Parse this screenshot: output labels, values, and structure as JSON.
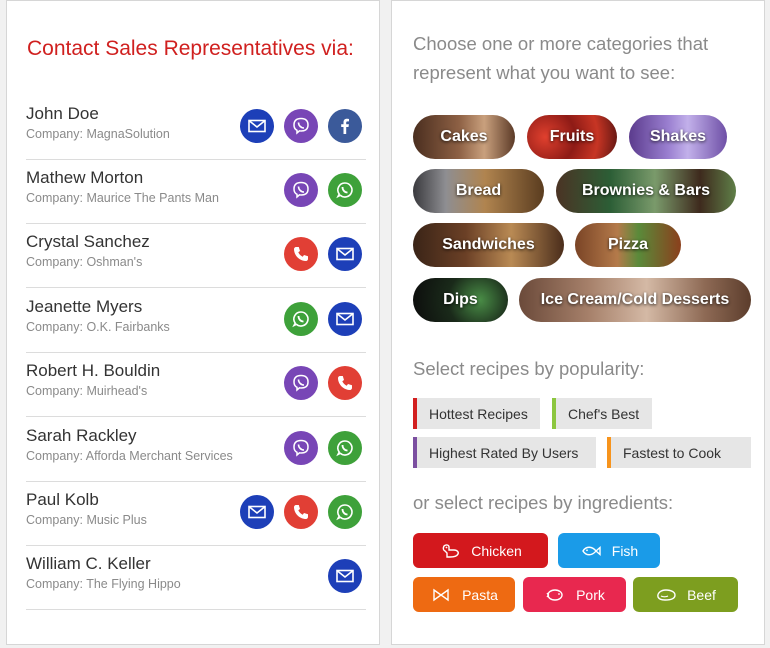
{
  "contacts_panel": {
    "title": "Contact Sales Representatives via:",
    "contacts": [
      {
        "name": "John Doe",
        "company": "Company: MagnaSolution",
        "channels": [
          "email",
          "viber",
          "facebook"
        ]
      },
      {
        "name": "Mathew Morton",
        "company": "Company: Maurice The Pants Man",
        "channels": [
          "viber",
          "whatsapp"
        ]
      },
      {
        "name": "Crystal Sanchez",
        "company": "Company: Oshman's",
        "channels": [
          "phone",
          "email"
        ]
      },
      {
        "name": "Jeanette Myers",
        "company": "Company: O.K. Fairbanks",
        "channels": [
          "whatsapp",
          "email"
        ]
      },
      {
        "name": "Robert H. Bouldin",
        "company": "Company: Muirhead's",
        "channels": [
          "viber",
          "phone"
        ]
      },
      {
        "name": "Sarah Rackley",
        "company": "Company: Afforda Merchant Services",
        "channels": [
          "viber",
          "whatsapp"
        ]
      },
      {
        "name": "Paul Kolb",
        "company": "Company: Music Plus",
        "channels": [
          "email",
          "phone",
          "whatsapp"
        ]
      },
      {
        "name": "William C. Keller",
        "company": "Company: The Flying Hippo",
        "channels": [
          "email"
        ]
      }
    ]
  },
  "recipes_panel": {
    "categories_prompt_line1": "Choose one or more categories that",
    "categories_prompt_line2": "represent what you want to see:",
    "categories": [
      {
        "label": "Cakes",
        "icon": "cake-photo"
      },
      {
        "label": "Fruits",
        "icon": "fruits-photo"
      },
      {
        "label": "Shakes",
        "icon": "shakes-photo"
      },
      {
        "label": "Bread",
        "icon": "bread-photo"
      },
      {
        "label": "Brownies & Bars",
        "icon": "brownies-photo"
      },
      {
        "label": "Sandwiches",
        "icon": "sandwiches-photo"
      },
      {
        "label": "Pizza",
        "icon": "pizza-photo"
      },
      {
        "label": "Dips",
        "icon": "dips-photo"
      },
      {
        "label": "Ice Cream/Cold Desserts",
        "icon": "ice-cream-photo"
      }
    ],
    "popularity_prompt": "Select recipes by popularity:",
    "popularity": [
      {
        "label": "Hottest Recipes",
        "color": "#d21f1f"
      },
      {
        "label": "Chef's Best",
        "color": "#8cc63f"
      },
      {
        "label": "Highest Rated By Users",
        "color": "#7b4fa0"
      },
      {
        "label": "Fastest to Cook",
        "color": "#f7941d"
      }
    ],
    "ingredients_prompt": "or select recipes by ingredients:",
    "ingredients": [
      {
        "label": "Chicken",
        "icon": "chicken-icon",
        "color": "#d3181d"
      },
      {
        "label": "Fish",
        "icon": "fish-icon",
        "color": "#1a9be8"
      },
      {
        "label": "Pasta",
        "icon": "pasta-icon",
        "color": "#ee6a12"
      },
      {
        "label": "Pork",
        "icon": "pork-icon",
        "color": "#e8284f"
      },
      {
        "label": "Beef",
        "icon": "beef-icon",
        "color": "#7d9e1f"
      }
    ]
  }
}
